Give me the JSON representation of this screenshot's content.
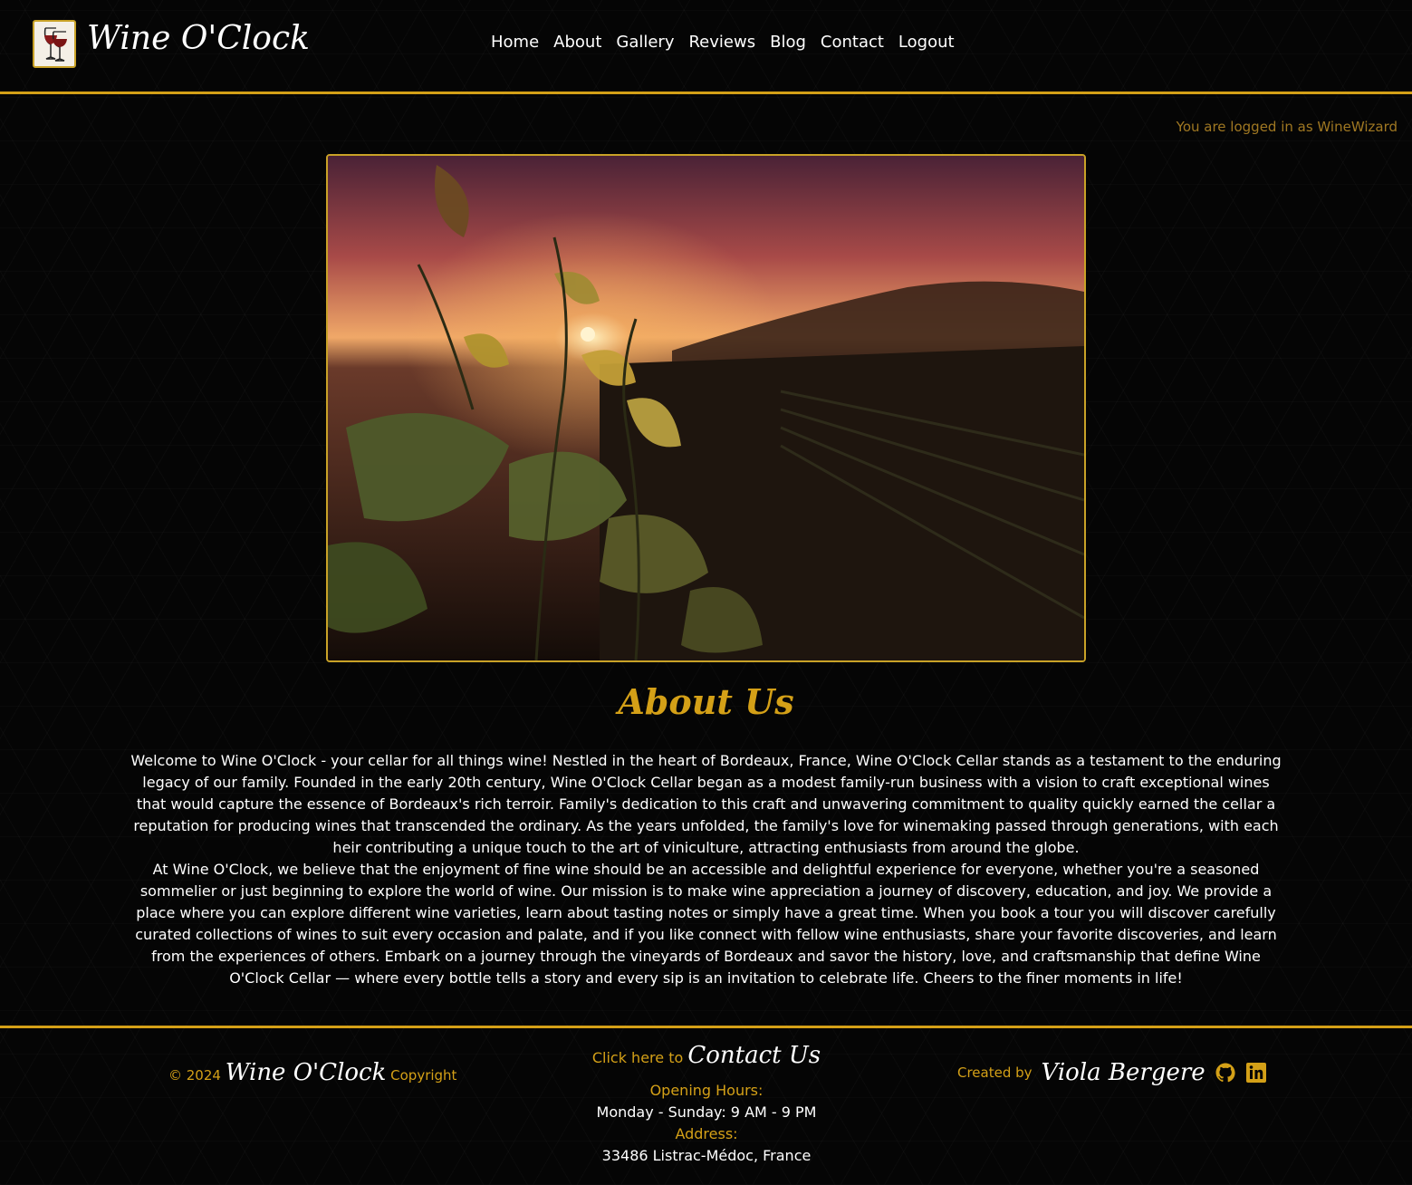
{
  "header": {
    "brand": "Wine O'Clock",
    "nav": [
      "Home",
      "About",
      "Gallery",
      "Reviews",
      "Blog",
      "Contact",
      "Logout"
    ]
  },
  "user": {
    "logged_in_text": "You are logged in as WineWizard"
  },
  "about": {
    "title": "About Us",
    "paragraph1": "Welcome to Wine O'Clock - your cellar for all things wine! Nestled in the heart of Bordeaux, France, Wine O'Clock Cellar stands as a testament to the enduring legacy of our family. Founded in the early 20th century, Wine O'Clock Cellar began as a modest family-run business with a vision to craft exceptional wines that would capture the essence of Bordeaux's rich terroir. Family's dedication to this craft and unwavering commitment to quality quickly earned the cellar a reputation for producing wines that transcended the ordinary. As the years unfolded, the family's love for winemaking passed through generations, with each heir contributing a unique touch to the art of viniculture, attracting enthusiasts from around the globe.",
    "paragraph2": "At Wine O'Clock, we believe that the enjoyment of fine wine should be an accessible and delightful experience for everyone, whether you're a seasoned sommelier or just beginning to explore the world of wine. Our mission is to make wine appreciation a journey of discovery, education, and joy. We provide a place where you can explore different wine varieties, learn about tasting notes or simply have a great time. When you book a tour you will discover carefully curated collections of wines to suit every occasion and palate, and if you like connect with fellow wine enthusiasts, share your favorite discoveries, and learn from the experiences of others. Embark on a journey through the vineyards of Bordeaux and savor the history, love, and craftsmanship that define Wine O'Clock Cellar — where every bottle tells a story and every sip is an invitation to celebrate life. Cheers to the finer moments in life!"
  },
  "footer": {
    "copyright_prefix": "© 2024",
    "copyright_brand": "Wine O'Clock",
    "copyright_suffix": "Copyright",
    "contact_prefix": "Click here to",
    "contact_link": "Contact Us",
    "hours_label": "Opening Hours:",
    "hours_value": "Monday - Sunday: 9 AM - 9 PM",
    "address_label": "Address:",
    "address_value": "33486 Listrac-Médoc, France",
    "created_prefix": "Created by",
    "creator": "Viola Bergere"
  },
  "icons": {
    "logo": "wine-glasses-icon",
    "social": [
      "github-icon",
      "linkedin-icon"
    ]
  },
  "colors": {
    "accent": "#d4a017",
    "background": "#050505",
    "muted_gold": "#a07822"
  }
}
